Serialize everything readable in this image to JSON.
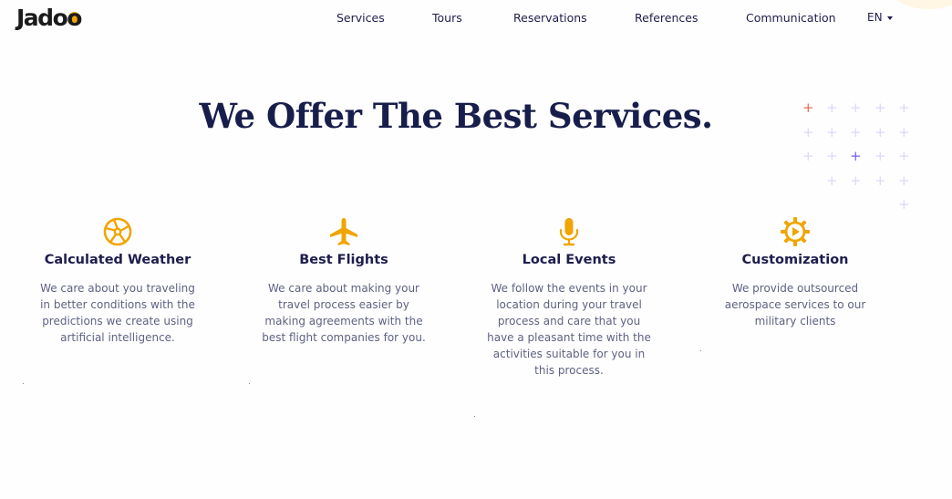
{
  "header": {
    "logo": "Jadoo",
    "nav": [
      {
        "label": "Services"
      },
      {
        "label": "Tours"
      },
      {
        "label": "Reservations"
      },
      {
        "label": "References"
      },
      {
        "label": "Communication"
      }
    ],
    "language": "EN"
  },
  "section": {
    "heading": "We Offer The Best Services."
  },
  "services": [
    {
      "icon": "satellite-dish-icon",
      "title": "Calculated Weather",
      "description": "We care about you traveling in better conditions with the predictions we create using artificial intelligence."
    },
    {
      "icon": "airplane-icon",
      "title": "Best Flights",
      "description": "We care about making your travel process easier by making agreements with the best flight companies for you."
    },
    {
      "icon": "microphone-icon",
      "title": "Local Events",
      "description": "We follow the events in your location during your travel process and care that you have a pleasant time with the activities suitable for you in this process."
    },
    {
      "icon": "gear-icon",
      "title": "Customization",
      "description": "We provide outsourced aerospace services to our military clients"
    }
  ],
  "colors": {
    "accent": "#f1a501",
    "heading": "#181e4b",
    "text": "#5e6282",
    "plus_orange": "#ef6d51",
    "plus_purple": "#7b5df6",
    "plus_light": "#dfd7f9"
  }
}
